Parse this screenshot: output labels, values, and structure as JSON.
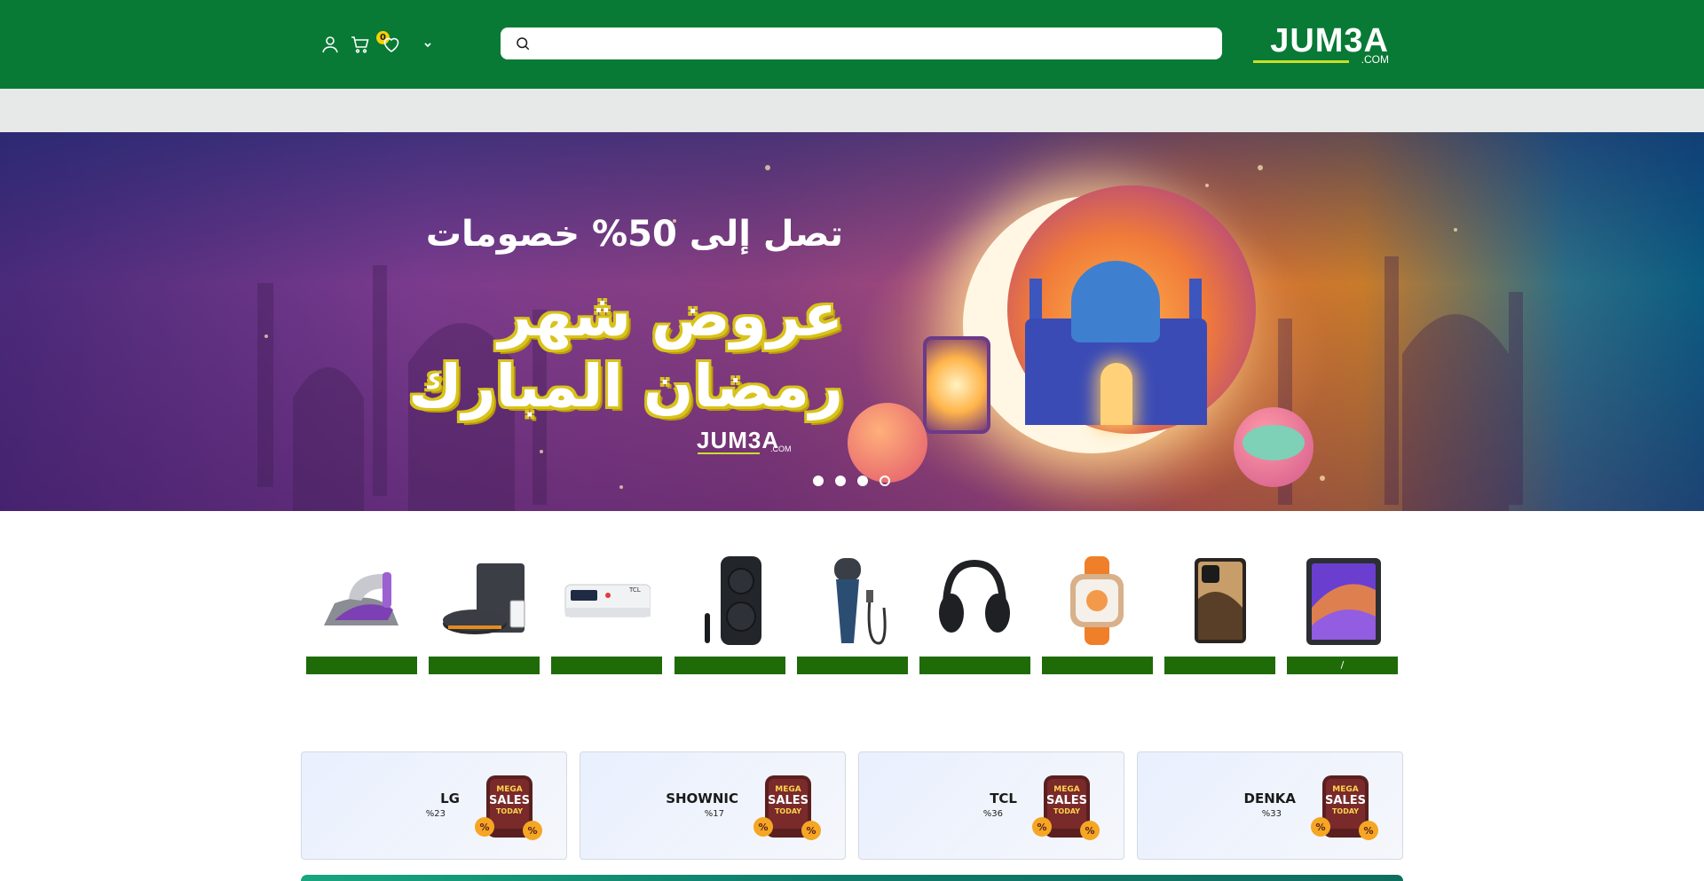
{
  "header": {
    "cart_count": "0",
    "search": {
      "placeholder": "",
      "value": ""
    },
    "logo": {
      "text": "JUM3A",
      "suffix": ".COM"
    },
    "icons": [
      "user-icon",
      "cart-icon",
      "heart-icon",
      "chevron-down-icon",
      "search-icon"
    ]
  },
  "hero": {
    "headline": "تصل إلى 50% خصومات",
    "title_line1": "عروض شهر",
    "title_line2": "رمضان المبارك",
    "logo": "JUM3A",
    "logo_suffix": ".COM",
    "slides": 4,
    "active_slide": 4
  },
  "products": [
    {
      "name": "steam-iron",
      "label": ""
    },
    {
      "name": "robot-vacuum",
      "label": ""
    },
    {
      "name": "air-conditioner",
      "label": ""
    },
    {
      "name": "party-speaker",
      "label": ""
    },
    {
      "name": "electric-shaver",
      "label": ""
    },
    {
      "name": "headphones",
      "label": ""
    },
    {
      "name": "smartwatch",
      "label": ""
    },
    {
      "name": "foldable-phone",
      "label": ""
    },
    {
      "name": "tablet",
      "label": "/"
    }
  ],
  "brands": [
    {
      "name": "LG",
      "discount": "%23"
    },
    {
      "name": "SHOWNIC",
      "discount": "%17"
    },
    {
      "name": "TCL",
      "discount": "%36"
    },
    {
      "name": "DENKA",
      "discount": "%33"
    }
  ],
  "mega_badge": {
    "line1": "MEGA",
    "line2": "SALES",
    "line3": "TODAY"
  },
  "colors": {
    "header_bg": "#087a35",
    "nav_strip": "#e7e8e8",
    "product_label_bg": "#1f6b08",
    "badge": "#f5d10a",
    "logo_underline": "#c9df2b"
  }
}
